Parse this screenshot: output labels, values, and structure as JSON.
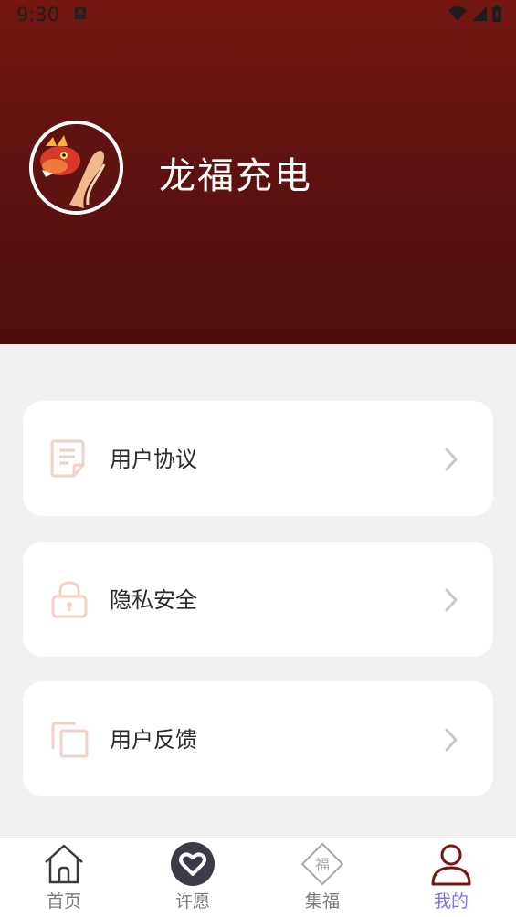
{
  "status_bar": {
    "time": "9:30",
    "notification_glyph": "A"
  },
  "profile": {
    "app_name": "龙福充电",
    "avatar_icon": "dragon-avatar"
  },
  "menu": [
    {
      "label": "用户协议",
      "icon": "document-icon"
    },
    {
      "label": "隐私安全",
      "icon": "lock-icon"
    },
    {
      "label": "用户反馈",
      "icon": "copy-icon"
    }
  ],
  "tabbar": [
    {
      "label": "首页",
      "icon": "home-icon",
      "active": false
    },
    {
      "label": "许愿",
      "icon": "heart-icon",
      "active": false
    },
    {
      "label": "集福",
      "icon": "fu-icon",
      "fu_char": "福",
      "active": false
    },
    {
      "label": "我的",
      "icon": "user-icon",
      "active": true
    }
  ],
  "colors": {
    "header": "#741612",
    "accent_active": "#7b73e0",
    "menu_icon": "#f1d2c8"
  }
}
